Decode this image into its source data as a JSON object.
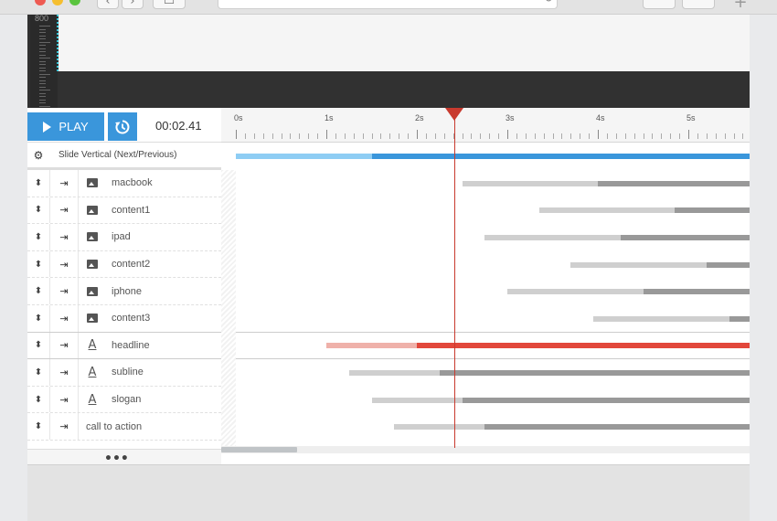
{
  "browser": {
    "back_icon": "‹",
    "forward_icon": "›",
    "sidebar_icon": "▭",
    "reload_icon": "↻",
    "new_tab_icon": "+",
    "traffic_colors": [
      "#ee5a52",
      "#f5be2f",
      "#5ac43e"
    ]
  },
  "preview": {
    "ruler_label": "800"
  },
  "toolbar": {
    "play_label": "PLAY",
    "time": "00:02.41"
  },
  "timescale": {
    "labels": [
      "0s",
      "1s",
      "2s",
      "3s",
      "4s",
      "5s"
    ]
  },
  "slide_row": {
    "label": "Slide Vertical (Next/Previous)",
    "gear_icon": "⚙"
  },
  "layers": [
    {
      "label": "macbook",
      "type": "image",
      "handle": "⬍",
      "arrow": "⇥"
    },
    {
      "label": "content1",
      "type": "image",
      "handle": "⬍",
      "arrow": "⇥"
    },
    {
      "label": "ipad",
      "type": "image",
      "handle": "⬍",
      "arrow": "⇥"
    },
    {
      "label": "content2",
      "type": "image",
      "handle": "⬍",
      "arrow": "⇥"
    },
    {
      "label": "iphone",
      "type": "image",
      "handle": "⬍",
      "arrow": "⇥"
    },
    {
      "label": "content3",
      "type": "image",
      "handle": "⬍",
      "arrow": "⇥"
    },
    {
      "label": "headline",
      "type": "text",
      "handle": "⬍",
      "arrow": "⇥",
      "text_icon": "A"
    },
    {
      "label": "subline",
      "type": "text",
      "handle": "⬍",
      "arrow": "⇥",
      "text_icon": "A"
    },
    {
      "label": "slogan",
      "type": "text",
      "handle": "⬍",
      "arrow": "⇥",
      "text_icon": "A"
    },
    {
      "label": "call to action",
      "type": "none",
      "handle": "⬍",
      "arrow": "⇥"
    }
  ],
  "more_label": "•••",
  "colors": {
    "accent": "#3a96db",
    "playhead": "#c83a2e",
    "bar_light": "#cfcfcf",
    "bar_dark": "#999999",
    "slide_light": "#8ecdf4",
    "slide_dark": "#3a96db",
    "headline_light": "#efb1aa",
    "headline_dark": "#e2473b"
  }
}
